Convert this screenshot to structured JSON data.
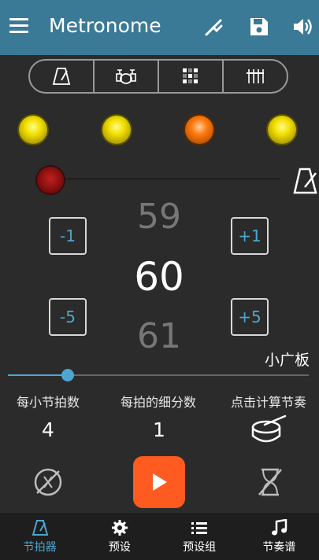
{
  "appbar": {
    "title": "Metronome"
  },
  "tempo": {
    "prev": "59",
    "current": "60",
    "next": "61",
    "name": "小广板",
    "slider_fraction": 0.2
  },
  "steps": {
    "minus1": "-1",
    "plus1": "+1",
    "minus5": "-5",
    "plus5": "+5"
  },
  "settings": {
    "beats_label": "每小节拍数",
    "beats_value": "4",
    "subdiv_label": "每拍的细分数",
    "subdiv_value": "1",
    "tap_label": "点击计算节奏"
  },
  "nav": {
    "metronome": "节拍器",
    "presets": "预设",
    "preset_groups": "预设组",
    "rhythm": "节奏谱"
  },
  "colors": {
    "appbar": "#3a7a96",
    "accent": "#4ea6d0",
    "play": "#ff5a1f",
    "beat": "#f2e000",
    "beat_accent": "#ff7a10"
  }
}
